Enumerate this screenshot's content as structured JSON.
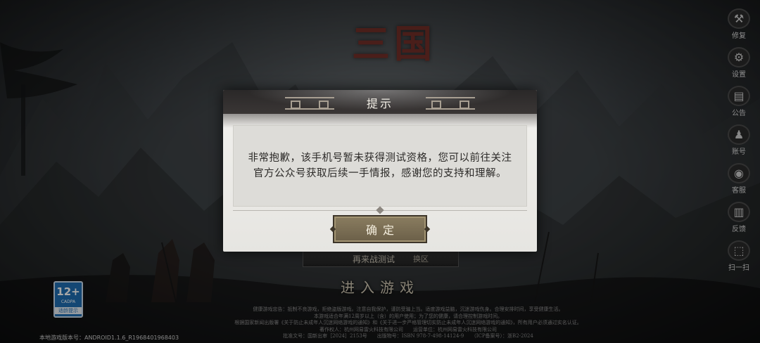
{
  "game": {
    "logo_text": "三国"
  },
  "side_menu": [
    {
      "icon": "wrench-icon",
      "glyph": "⚒",
      "label": "修复"
    },
    {
      "icon": "gear-icon",
      "glyph": "⚙",
      "label": "设置"
    },
    {
      "icon": "notice-icon",
      "glyph": "▤",
      "label": "公告"
    },
    {
      "icon": "account-icon",
      "glyph": "♟",
      "label": "账号"
    },
    {
      "icon": "service-icon",
      "glyph": "◉",
      "label": "客服"
    },
    {
      "icon": "book-icon",
      "glyph": "▥",
      "label": "反馈"
    },
    {
      "icon": "scan-icon",
      "glyph": "⬚",
      "label": "扫一扫"
    }
  ],
  "server_bar": {
    "name": "再来战测试",
    "switch_label": "换区"
  },
  "enter_game_label": "进入游戏",
  "age_rating": {
    "age": "12+",
    "org": "CADPA",
    "tip": "适龄提示"
  },
  "notice_lines": [
    "健康游戏忠告：抵制不良游戏，拒绝盗版游戏。注意自我保护，谨防受骗上当。适度游戏益脑，沉迷游戏伤身。合理安排时间，享受健康生活。",
    "本游戏适合年满12周岁以上（含）的用户使用；为了您的健康，请合理控制游戏时间。",
    "根据国家新闻出版署《关于防止未成年人沉迷网络游戏的通知》和《关于进一步严格管理切实防止未成年人沉迷网络游戏的通知》，所有用户必须通过实名认证。",
    "著作权人：杭州网易雷火科技有限公司　　运营单位：杭州网易雷火科技有限公司",
    "批准文号：国新出审［2024］2153号　　出版物号：ISBN 978-7-498-14124-9　　（ICP备案号）：浙B2-2024"
  ],
  "version": {
    "label": "本地游戏版本号：",
    "value": "ANDROID1.1.6_R1968401968403"
  },
  "dialog": {
    "title": "提示",
    "message_line1": "非常抱歉，该手机号暂未获得测试资格，您可以前往关注",
    "message_line2": "官方公众号获取后续一手情报，感谢您的支持和理解。",
    "confirm_label": "确定"
  }
}
